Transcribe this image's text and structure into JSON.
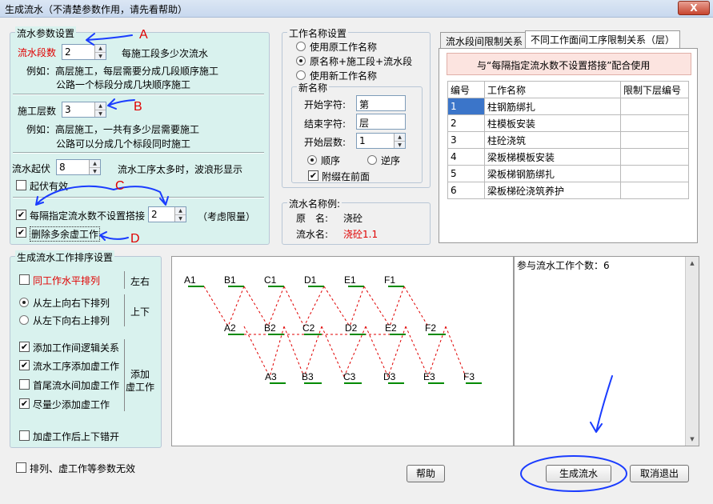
{
  "window": {
    "title": "生成流水（不清楚参数作用，请先看帮助）",
    "close": "X"
  },
  "params": {
    "legend": "流水参数设置",
    "seg_label": "流水段数",
    "seg_value": "2",
    "seg_desc": "每施工段多少次流水",
    "seg_ex1": "例如：高层施工，每层需要分成几段顺序施工",
    "seg_ex2": "公路一个标段分成几块顺序施工",
    "layer_label": "施工层数",
    "layer_value": "3",
    "layer_ex1": "例如：高层施工，一共有多少层需要施工",
    "layer_ex2": "公路可以分成几个标段同时施工",
    "wave_label": "流水起伏",
    "wave_value": "8",
    "wave_desc": "流水工序太多时，波浪形显示",
    "wave_check": "起伏有效",
    "skip_label": "每隔指定流水数不设置搭接",
    "skip_value": "2",
    "skip_note": "（考虑限量）",
    "delete_label": "删除多余虚工作"
  },
  "annotations": {
    "a": "A",
    "b": "B",
    "c": "C",
    "d": "D"
  },
  "naming": {
    "legend": "工作名称设置",
    "opt1": "使用原工作名称",
    "opt2": "原名称+施工段+流水段",
    "opt3": "使用新工作名称",
    "new_legend": "新名称",
    "start_char_label": "开始字符:",
    "start_char_value": "第",
    "end_char_label": "结束字符:",
    "end_char_value": "层",
    "start_layer_label": "开始层数:",
    "start_layer_value": "1",
    "order_asc": "顺序",
    "order_desc": "逆序",
    "attach_front": "附缀在前面"
  },
  "example": {
    "legend": "流水名称例:",
    "orig_label": "原　名:",
    "orig_value": "浇砼",
    "flow_label": "流水名:",
    "flow_value": "浇砼1.1"
  },
  "tabs": {
    "tab1": "流水段间限制关系",
    "tab2": "不同工作面间工序限制关系（层）"
  },
  "limit": {
    "note": "与“每隔指定流水数不设置搭接”配合使用",
    "headers": [
      "编号",
      "工作名称",
      "限制下层编号"
    ],
    "rows": [
      [
        "1",
        "柱钢筋绑扎",
        ""
      ],
      [
        "2",
        "柱模板安装",
        ""
      ],
      [
        "3",
        "柱砼浇筑",
        ""
      ],
      [
        "4",
        "梁板梯模板安装",
        ""
      ],
      [
        "5",
        "梁板梯钢筋绑扎",
        ""
      ],
      [
        "6",
        "梁板梯砼浇筑养护",
        ""
      ]
    ]
  },
  "sort": {
    "legend": "生成流水工作排序设置",
    "same_row": "同工作水平排列",
    "lr_label": "左右",
    "lt_rb": "从左上向右下排列",
    "lb_rt": "从左下向右上排列",
    "ud_label": "上下",
    "add_logic": "添加工作间逻辑关系",
    "add_dummy": "流水工序添加虚工作",
    "head_tail": "首尾流水间加虚工作",
    "min_dummy": "尽量少添加虚工作",
    "dummy_label1": "添加",
    "dummy_label2": "虚工作",
    "offset": "加虚工作后上下错开"
  },
  "diagram": {
    "row1": [
      "A1",
      "B1",
      "C1",
      "D1",
      "E1",
      "F1"
    ],
    "row2": [
      "A2",
      "B2",
      "C2",
      "D2",
      "E2",
      "F2"
    ],
    "row3": [
      "A3",
      "B3",
      "C3",
      "D3",
      "E3",
      "F3"
    ]
  },
  "info": {
    "count_text": "参与流水工作个数：6"
  },
  "footer": {
    "invalid_check": "排列、虚工作等参数无效",
    "help": "帮助",
    "generate": "生成流水",
    "cancel": "取消退出"
  },
  "colors": {
    "annotation": "#1a3cff",
    "link": "#e00000",
    "bar": "#008a00",
    "teal": "#d9f2ee"
  }
}
